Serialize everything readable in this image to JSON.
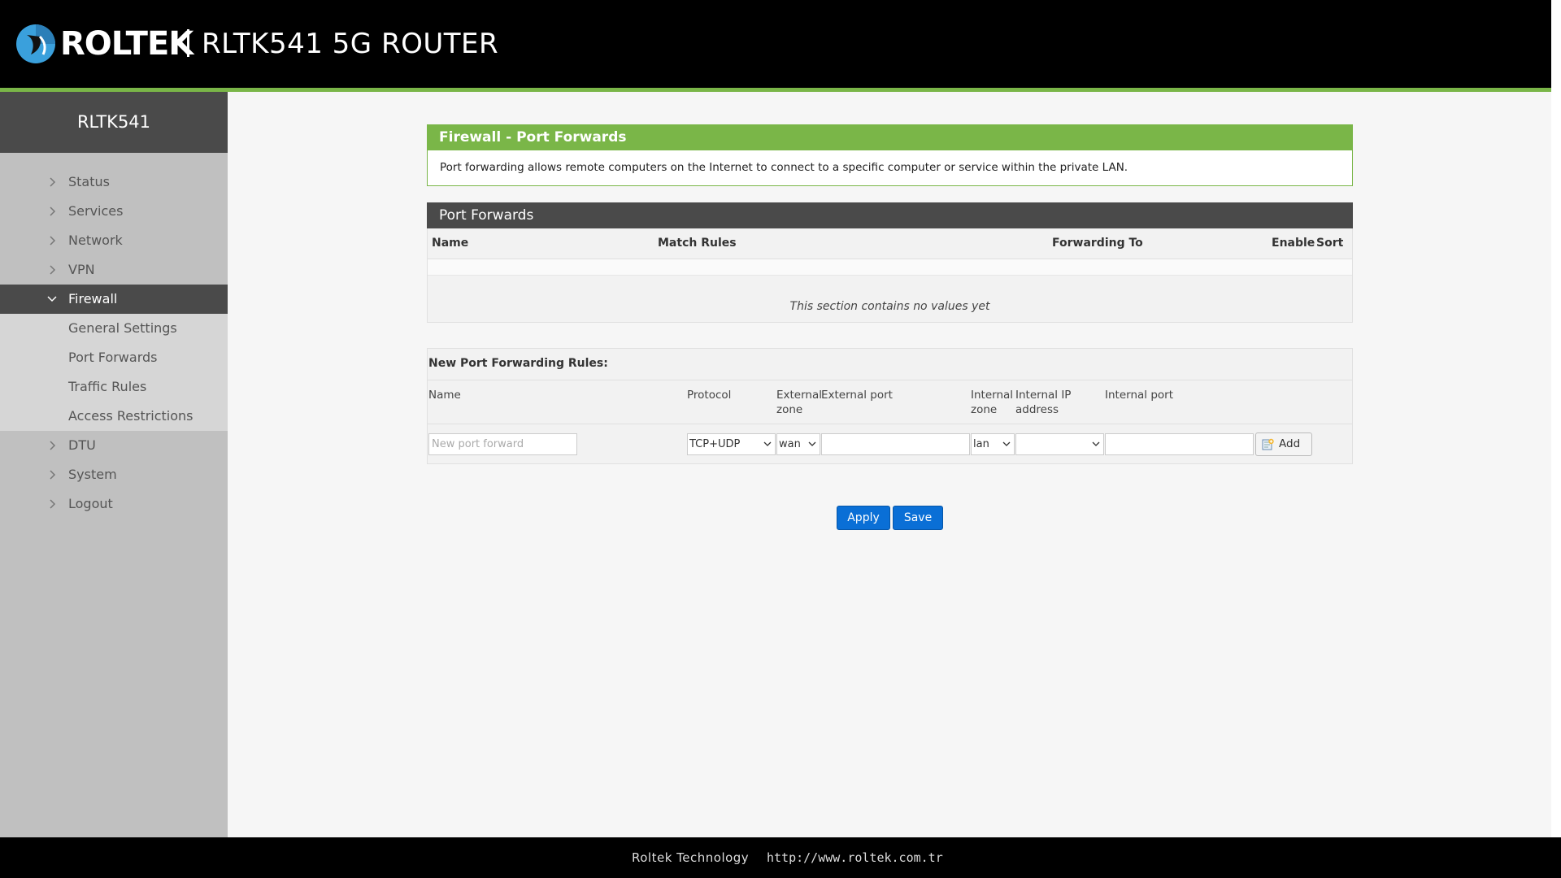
{
  "header": {
    "brand": "ROLTEK",
    "model_title": "RLTK541 5G ROUTER"
  },
  "sidebar": {
    "device_name": "RLTK541",
    "items": [
      {
        "label": "Status"
      },
      {
        "label": "Services"
      },
      {
        "label": "Network"
      },
      {
        "label": "VPN"
      },
      {
        "label": "Firewall",
        "active": true
      },
      {
        "label": "DTU"
      },
      {
        "label": "System"
      },
      {
        "label": "Logout"
      }
    ],
    "firewall_sub": [
      {
        "label": "General Settings"
      },
      {
        "label": "Port Forwards"
      },
      {
        "label": "Traffic Rules"
      },
      {
        "label": "Access Restrictions"
      }
    ]
  },
  "main": {
    "page_title": "Firewall - Port Forwards",
    "description": "Port forwarding allows remote computers on the Internet to connect to a specific computer or service within the private LAN.",
    "port_forwards": {
      "title": "Port Forwards",
      "columns": [
        "Name",
        "Match Rules",
        "Forwarding To",
        "Enable",
        "Sort"
      ],
      "empty_text": "This section contains no values yet"
    },
    "new_rules": {
      "title": "New Port Forwarding Rules:",
      "labels": {
        "name": "Name",
        "protocol": "Protocol",
        "external_zone_1": "External",
        "external_zone_2": "zone",
        "external_port": "External port",
        "internal_zone_1": "Internal",
        "internal_zone_2": "zone",
        "internal_ip_1": "Internal IP",
        "internal_ip_2": "address",
        "internal_port": "Internal port"
      },
      "name_placeholder": "New port forward",
      "protocol_value": "TCP+UDP",
      "external_zone_value": "wan",
      "external_port_value": "",
      "internal_zone_value": "lan",
      "internal_ip_value": "",
      "internal_port_value": "",
      "add_label": "Add"
    },
    "apply_label": "Apply",
    "save_label": "Save"
  },
  "footer": {
    "company": "Roltek Technology",
    "url": "http://www.roltek.com.tr"
  },
  "colors": {
    "accent_green": "#7ab648",
    "header_black": "#000000",
    "button_blue": "#0a6fd6",
    "sidebar_dark": "#4a4a4a",
    "logo_blue": "#3aa0dc"
  }
}
